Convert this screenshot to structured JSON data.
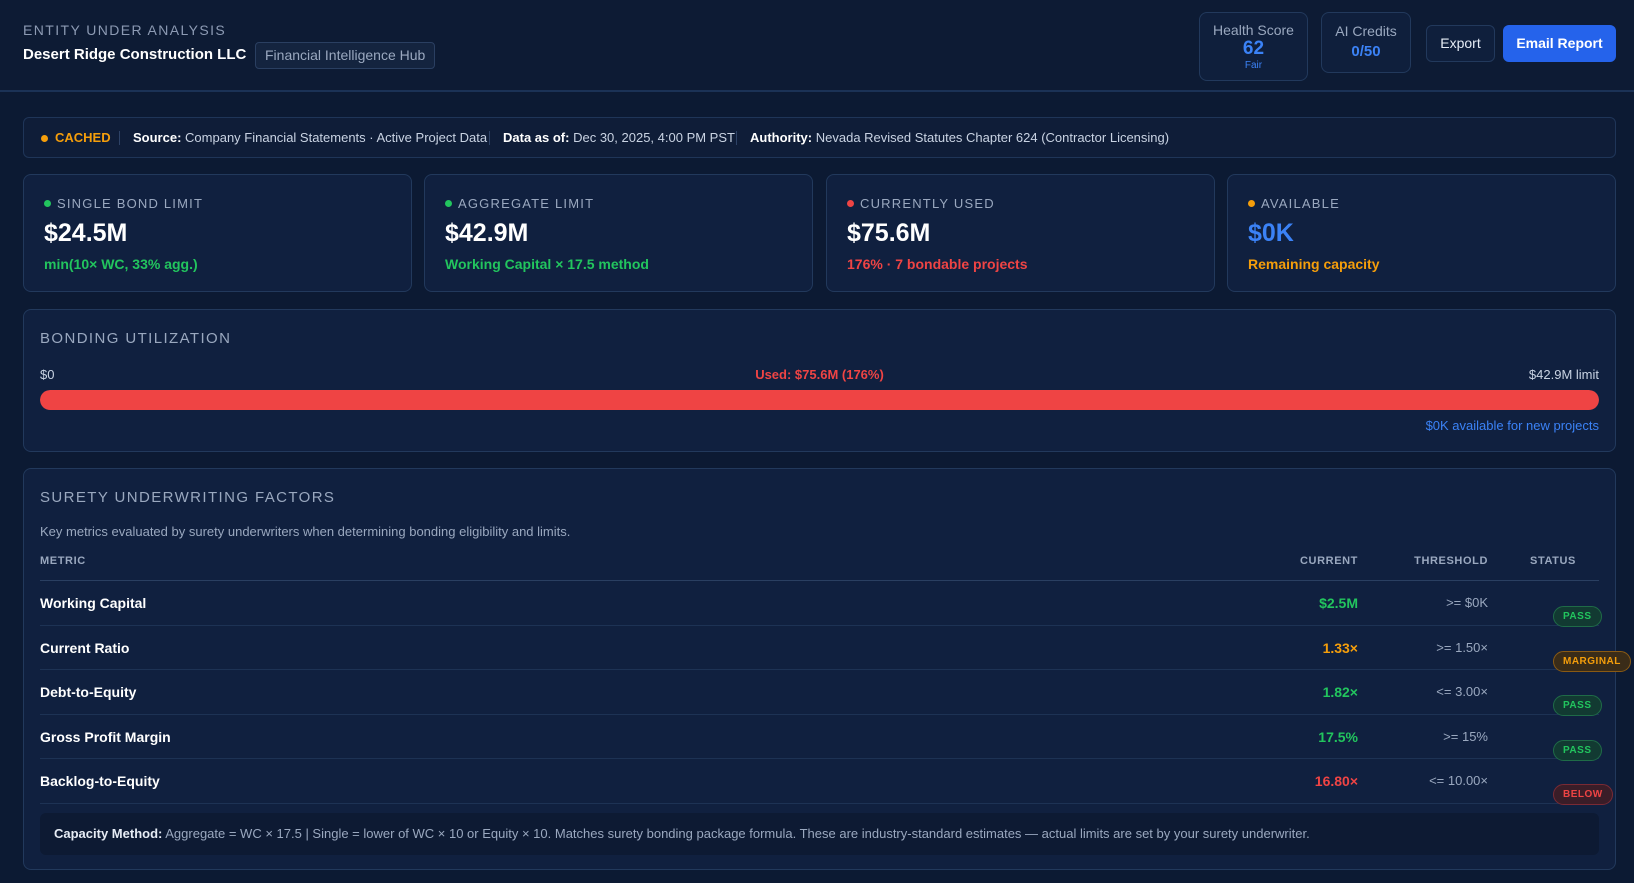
{
  "header": {
    "kicker": "ENTITY UNDER ANALYSIS",
    "entity_name": "Desert Ridge Construction LLC",
    "hub_tag": "Financial Intelligence Hub",
    "health": {
      "label": "Health Score",
      "value": "62",
      "rating": "Fair"
    },
    "credits": {
      "label": "AI Credits",
      "value": "0/50"
    },
    "export_label": "Export",
    "email_label": "Email Report"
  },
  "status": {
    "cache_label": "CACHED",
    "source_key": "Source:",
    "source_val": "Company Financial Statements · Active Project Data",
    "asof_key": "Data as of:",
    "asof_val": "Dec 30, 2025, 4:00 PM PST",
    "authority_key": "Authority:",
    "authority_val": "Nevada Revised Statutes Chapter 624 (Contractor Licensing)"
  },
  "cards": [
    {
      "label": "SINGLE BOND LIMIT",
      "value": "$24.5M",
      "sub": "min(10× WC, 33% agg.)",
      "dot_color": "#22c55e",
      "value_color": "#ffffff",
      "sub_color": "#22c55e"
    },
    {
      "label": "AGGREGATE LIMIT",
      "value": "$42.9M",
      "sub": "Working Capital × 17.5 method",
      "dot_color": "#22c55e",
      "value_color": "#ffffff",
      "sub_color": "#22c55e"
    },
    {
      "label": "CURRENTLY USED",
      "value": "$75.6M",
      "sub": "176% · 7 bondable projects",
      "dot_color": "#ef4444",
      "value_color": "#ffffff",
      "sub_color": "#ef4444"
    },
    {
      "label": "AVAILABLE",
      "value": "$0K",
      "sub": "Remaining capacity",
      "dot_color": "#f59e0b",
      "value_color": "#3b82f6",
      "sub_color": "#f59e0b"
    }
  ],
  "utilization": {
    "title": "BONDING UTILIZATION",
    "start_label": "$0",
    "used_label": "Used: $75.6M (176%)",
    "limit_label": "$42.9M limit",
    "available_label": "$0K available for new projects",
    "fill_fraction": 1.0
  },
  "surety": {
    "title": "SURETY UNDERWRITING FACTORS",
    "description": "Key metrics evaluated by surety underwriters when determining bonding eligibility and limits.",
    "columns": {
      "metric": "METRIC",
      "current": "CURRENT",
      "threshold": "THRESHOLD",
      "status": "STATUS"
    },
    "rows": [
      {
        "metric": "Working Capital",
        "current": "$2.5M",
        "threshold": ">= $0K",
        "status": "PASS",
        "color": "#22c55e",
        "kind": "pass"
      },
      {
        "metric": "Current Ratio",
        "current": "1.33×",
        "threshold": ">= 1.50×",
        "status": "MARGINAL",
        "color": "#f59e0b",
        "kind": "marginal"
      },
      {
        "metric": "Debt-to-Equity",
        "current": "1.82×",
        "threshold": "<= 3.00×",
        "status": "PASS",
        "color": "#22c55e",
        "kind": "pass"
      },
      {
        "metric": "Gross Profit Margin",
        "current": "17.5%",
        "threshold": ">= 15%",
        "status": "PASS",
        "color": "#22c55e",
        "kind": "pass"
      },
      {
        "metric": "Backlog-to-Equity",
        "current": "16.80×",
        "threshold": "<= 10.00×",
        "status": "BELOW",
        "color": "#ef4444",
        "kind": "below"
      }
    ],
    "method_key": "Capacity Method:",
    "method_text": "Aggregate = WC × 17.5 | Single = lower of WC × 10 or Equity × 10. Matches surety bonding package formula. These are industry-standard estimates — actual limits are set by your surety underwriter."
  }
}
